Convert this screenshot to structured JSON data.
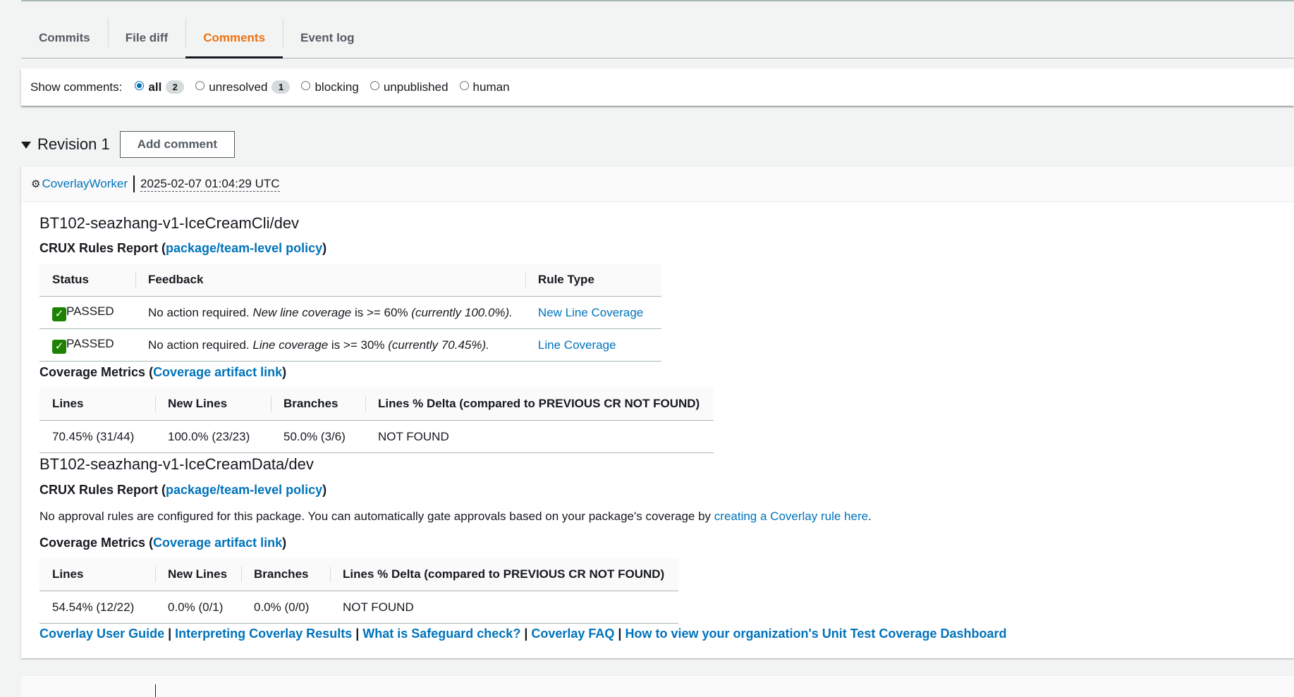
{
  "tabs": [
    {
      "label": "Commits",
      "active": false
    },
    {
      "label": "File diff",
      "active": false
    },
    {
      "label": "Comments",
      "active": true
    },
    {
      "label": "Event log",
      "active": false
    }
  ],
  "filter": {
    "label": "Show comments:",
    "options": [
      {
        "label": "all",
        "selected": true,
        "count": "2"
      },
      {
        "label": "unresolved",
        "selected": false,
        "count": "1"
      },
      {
        "label": "blocking",
        "selected": false
      },
      {
        "label": "unpublished",
        "selected": false
      },
      {
        "label": "human",
        "selected": false
      }
    ]
  },
  "revision": {
    "title": "Revision 1",
    "add_comment": "Add comment"
  },
  "comment": {
    "author": "CoverlayWorker",
    "timestamp": "2025-02-07 01:04:29 UTC",
    "sections": [
      {
        "package": "BT102-seazhang-v1-IceCreamCli/dev",
        "rules_title": "CRUX Rules Report (",
        "rules_link": "package/team-level policy",
        "rules_close": ")",
        "rules_headers": [
          "Status",
          "Feedback",
          "Rule Type"
        ],
        "rules_rows": [
          {
            "status": "PASSED",
            "feedback_plain": "No action required. ",
            "feedback_italic1": "New line coverage",
            "feedback_mid": " is >= 60% ",
            "feedback_italic2": "(currently 100.0%).",
            "rule_type": "New Line Coverage"
          },
          {
            "status": "PASSED",
            "feedback_plain": "No action required. ",
            "feedback_italic1": "Line coverage",
            "feedback_mid": " is >= 30% ",
            "feedback_italic2": "(currently 70.45%).",
            "rule_type": "Line Coverage"
          }
        ],
        "metrics_title": "Coverage Metrics (",
        "metrics_link": "Coverage artifact link",
        "metrics_close": ")",
        "metrics_headers": [
          "Lines",
          "New Lines",
          "Branches",
          "Lines % Delta (compared to PREVIOUS CR NOT FOUND)"
        ],
        "metrics_row": [
          "70.45% (31/44)",
          "100.0% (23/23)",
          "50.0% (3/6)",
          "NOT FOUND"
        ]
      },
      {
        "package": "BT102-seazhang-v1-IceCreamData/dev",
        "rules_title": "CRUX Rules Report (",
        "rules_link": "package/team-level policy",
        "rules_close": ")",
        "no_rules_text": "No approval rules are configured for this package. You can automatically gate approvals based on your package's coverage by ",
        "no_rules_link": "creating a Coverlay rule here",
        "no_rules_end": ".",
        "metrics_title": "Coverage Metrics (",
        "metrics_link": "Coverage artifact link",
        "metrics_close": ")",
        "metrics_headers": [
          "Lines",
          "New Lines",
          "Branches",
          "Lines % Delta (compared to PREVIOUS CR NOT FOUND)"
        ],
        "metrics_row": [
          "54.54% (12/22)",
          "0.0% (0/1)",
          "0.0% (0/0)",
          "NOT FOUND"
        ]
      }
    ],
    "footer_links": [
      "Coverlay User Guide",
      "Interpreting Coverlay Results",
      "What is Safeguard check?",
      "Coverlay FAQ",
      "How to view your organization's Unit Test Coverage Dashboard"
    ],
    "footer_sep": " | "
  },
  "colors": {
    "accent": "#ec7211",
    "link": "#0073bb",
    "passed": "#1d8102"
  }
}
